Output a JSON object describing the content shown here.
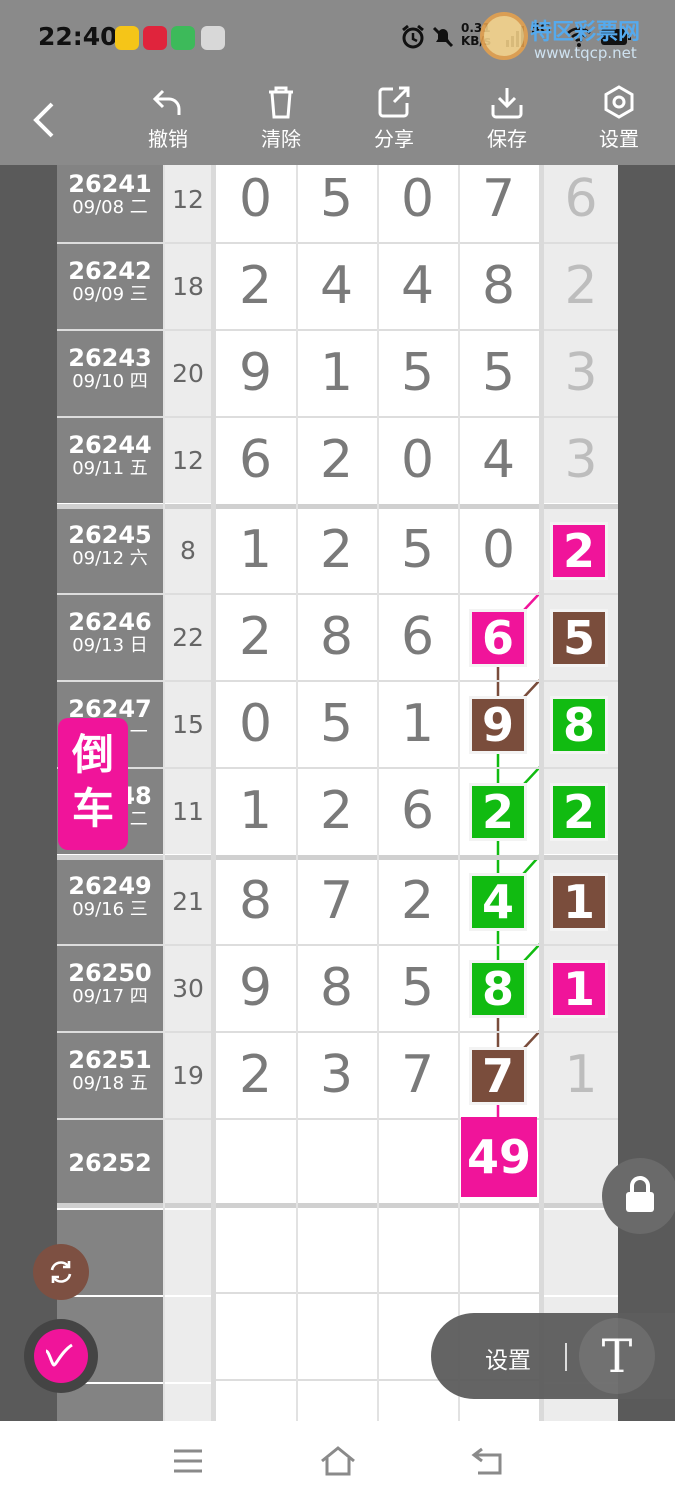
{
  "status_bar": {
    "time": "22:40",
    "net_speed": "0.31\nKB/s",
    "network": "5G",
    "app_icon_colors": [
      "#f5c518",
      "#e0243c",
      "#3dba5a",
      "#d8d8d8"
    ],
    "icons": [
      "alarm-icon",
      "mute-icon",
      "signal-icon",
      "wifi-icon",
      "battery-icon"
    ]
  },
  "watermark": {
    "title": "特区彩票网",
    "url": "www.tqcp.net"
  },
  "toolbar": {
    "undo": "撤销",
    "clear": "清除",
    "share": "分享",
    "save": "保存",
    "settings": "设置"
  },
  "rows": [
    {
      "issue": "26241",
      "date": "09/08 二",
      "sum": "12",
      "digits": [
        "0",
        "5",
        "0",
        "7"
      ],
      "last": "6"
    },
    {
      "issue": "26242",
      "date": "09/09 三",
      "sum": "18",
      "digits": [
        "2",
        "4",
        "4",
        "8"
      ],
      "last": "2"
    },
    {
      "issue": "26243",
      "date": "09/10 四",
      "sum": "20",
      "digits": [
        "9",
        "1",
        "5",
        "5"
      ],
      "last": "3"
    },
    {
      "issue": "26244",
      "date": "09/11 五",
      "sum": "12",
      "digits": [
        "6",
        "2",
        "0",
        "4"
      ],
      "last": "3"
    },
    {
      "issue": "26245",
      "date": "09/12 六",
      "sum": "8",
      "digits": [
        "1",
        "2",
        "5",
        "0"
      ],
      "last": "2"
    },
    {
      "issue": "26246",
      "date": "09/13 日",
      "sum": "22",
      "digits": [
        "2",
        "8",
        "6",
        "6"
      ],
      "last": "5"
    },
    {
      "issue": "26247",
      "date": "09/14 一",
      "sum": "15",
      "digits": [
        "0",
        "5",
        "1",
        "9"
      ],
      "last": "8"
    },
    {
      "issue": "26248",
      "date": "09/15 二",
      "sum": "11",
      "digits": [
        "1",
        "2",
        "6",
        "2"
      ],
      "last": "2"
    },
    {
      "issue": "26249",
      "date": "09/16 三",
      "sum": "21",
      "digits": [
        "8",
        "7",
        "2",
        "4"
      ],
      "last": "1"
    },
    {
      "issue": "26250",
      "date": "09/17 四",
      "sum": "30",
      "digits": [
        "9",
        "8",
        "5",
        "8"
      ],
      "last": "1"
    },
    {
      "issue": "26251",
      "date": "09/18 五",
      "sum": "19",
      "digits": [
        "2",
        "3",
        "7",
        "7"
      ],
      "last": "1"
    },
    {
      "issue": "26252",
      "date": "",
      "sum": "",
      "digits": [
        "",
        "",
        "",
        ""
      ],
      "last": ""
    }
  ],
  "highlights": {
    "col4": [
      {
        "row": 5,
        "color": "#f0149a"
      },
      {
        "row": 6,
        "color": "#7a4d3c"
      },
      {
        "row": 7,
        "color": "#11bb11"
      },
      {
        "row": 8,
        "color": "#11bb11"
      },
      {
        "row": 9,
        "color": "#11bb11"
      },
      {
        "row": 10,
        "color": "#7a4d3c"
      }
    ],
    "last": [
      {
        "row": 4,
        "color": "#f0149a"
      },
      {
        "row": 5,
        "color": "#7a4d3c"
      },
      {
        "row": 6,
        "color": "#11bb11"
      },
      {
        "row": 7,
        "color": "#11bb11"
      },
      {
        "row": 8,
        "color": "#7a4d3c"
      },
      {
        "row": 9,
        "color": "#f0149a"
      }
    ],
    "prediction": "49",
    "prediction_color": "#f0149a"
  },
  "floating": {
    "reverse_line1": "倒",
    "reverse_line2": "车",
    "settings_label": "设置",
    "text_tool": "T",
    "lock_icon": "lock-icon",
    "refresh_icon": "refresh-icon",
    "pen_icon": "pen-icon"
  },
  "navbar": [
    "menu-icon",
    "home-icon",
    "back-icon"
  ]
}
